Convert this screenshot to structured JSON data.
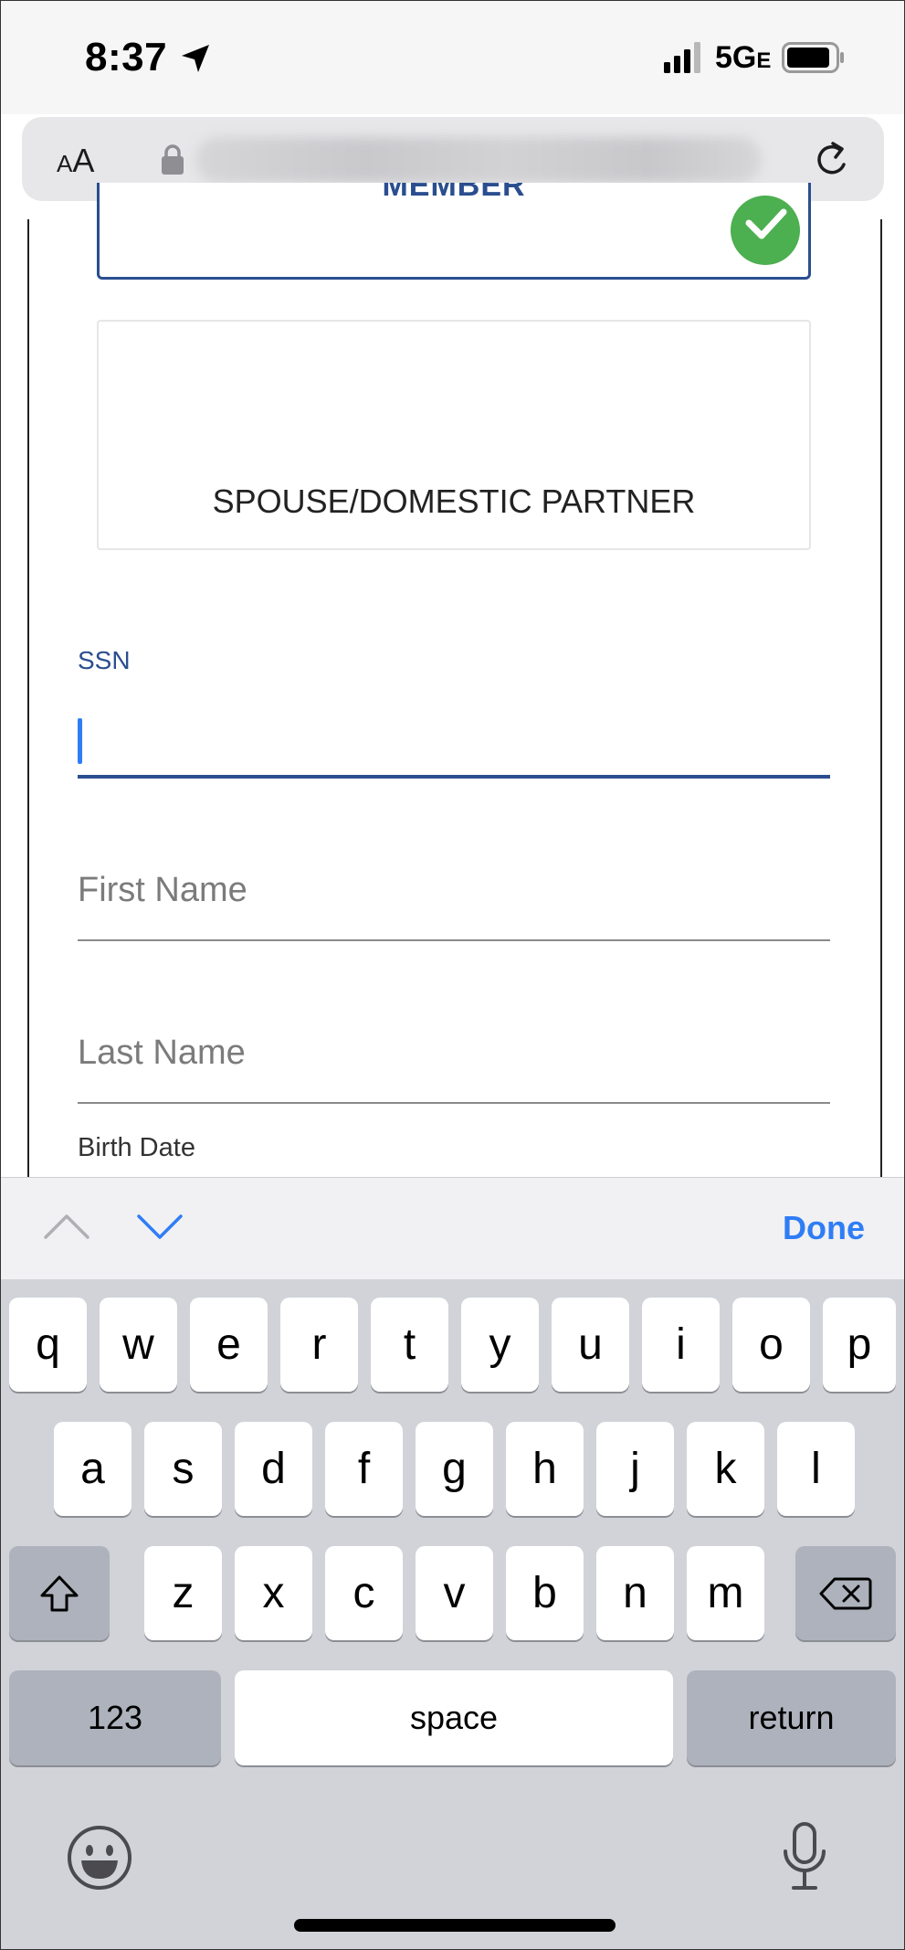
{
  "status_bar": {
    "time": "8:37",
    "network": "5G",
    "network_suffix": "E",
    "icons": [
      "location-arrow-icon",
      "signal-bars-icon",
      "battery-icon"
    ]
  },
  "browser": {
    "aa_large": "A",
    "aa_small": "A",
    "icons": [
      "lock-icon",
      "reload-icon"
    ]
  },
  "form": {
    "member_label": "MEMBER",
    "spouse_label": "SPOUSE/DOMESTIC PARTNER",
    "ssn_label": "SSN",
    "ssn_value": "",
    "first_name_placeholder": "First Name",
    "last_name_placeholder": "Last Name",
    "birth_date_label": "Birth Date",
    "accent_color": "#2a4e8f",
    "check_color": "#4caf50"
  },
  "accessory": {
    "done_label": "Done"
  },
  "keyboard": {
    "row1": [
      "q",
      "w",
      "e",
      "r",
      "t",
      "y",
      "u",
      "i",
      "o",
      "p"
    ],
    "row2": [
      "a",
      "s",
      "d",
      "f",
      "g",
      "h",
      "j",
      "k",
      "l"
    ],
    "row3": [
      "z",
      "x",
      "c",
      "v",
      "b",
      "n",
      "m"
    ],
    "numbers_label": "123",
    "space_label": "space",
    "return_label": "return"
  }
}
